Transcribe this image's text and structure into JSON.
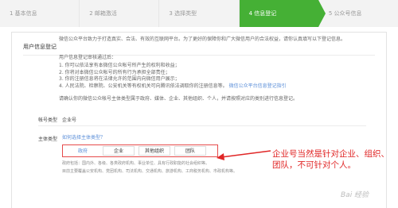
{
  "steps": [
    {
      "label": "1 基本信息"
    },
    {
      "label": "2 邮箱激活"
    },
    {
      "label": "3 选择类型"
    },
    {
      "label": "4 信息登记"
    },
    {
      "label": "5 公众号信息"
    }
  ],
  "section": {
    "title": "用户信息登记"
  },
  "intro": {
    "p1": "微信公众平台致力于打造真实、合法、有效的互联网平台。为了更好的保障你和广大微信用户的合法权益，请你认真填写以下登记信息。",
    "p2": "用户信息登记审核通过后：",
    "items": [
      "1. 你可以依法享有本微信公众帐号所产生的权利和收益；",
      "2. 你将对本微信公众帐号的所有行为承担全部责任；",
      "3. 你的注册信息将在法律允许的范围内向微信用户展示；",
      "4. 人民法院、检察院、公安机关等有权机关可向腾讯依法调取你的注册信息等。"
    ],
    "items_link": "微信公众平台信息登记指引",
    "p3": "请确认你的微信公众帐号主体类型属于政府、媒体、企业、其他组织、个人，并请按照对应的类别进行信息登记。"
  },
  "account": {
    "label": "帐号类型",
    "value": "企业号"
  },
  "subject": {
    "label": "主体类型",
    "link": "如何选择主体类型？",
    "options": [
      "政府",
      "企业",
      "其他组织",
      "团队"
    ],
    "note1": "政府包括：国内外、各级、各类政府机构、事业单位、具有行政职能的社会组织等。",
    "note2": "目前主要覆盖公安机构、党团机构、司法机构、交通机构、旅游机构、工商税务机构、市政机构等。"
  },
  "annotation": {
    "text": "企业号当然是针对企业、组织、团队，不可针对个人。"
  },
  "watermark": {
    "text": "Bai 经验"
  },
  "colors": {
    "accent": "#45b035",
    "link": "#5a8ed8",
    "annotation": "#e02626"
  }
}
